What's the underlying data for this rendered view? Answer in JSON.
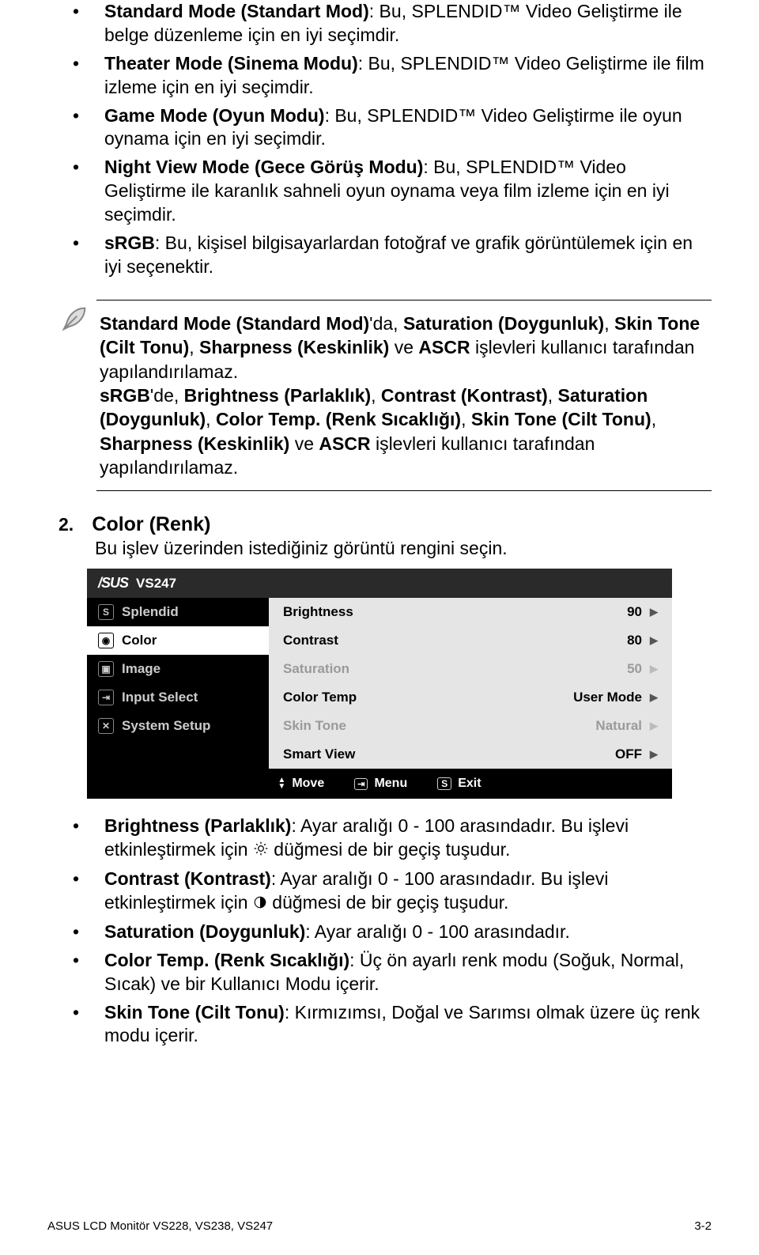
{
  "splendid_modes": [
    {
      "title": "Standard Mode (Standart Mod)",
      "desc": ": Bu, SPLENDID™ Video Geliştirme ile belge düzenleme için en iyi seçimdir."
    },
    {
      "title": "Theater Mode (Sinema Modu)",
      "desc": ": Bu, SPLENDID™ Video Geliştirme ile film izleme için en iyi seçimdir."
    },
    {
      "title": "Game Mode (Oyun Modu)",
      "desc": ": Bu, SPLENDID™ Video Geliştirme ile oyun oynama için en iyi seçimdir."
    },
    {
      "title": "Night View Mode (Gece Görüş Modu)",
      "desc": ": Bu, SPLENDID™ Video Geliştirme ile karanlık sahneli oyun oynama veya film izleme için en iyi seçimdir."
    },
    {
      "title": "sRGB",
      "desc": ": Bu, kişisel bilgisayarlardan fotoğraf ve grafik görüntülemek için en iyi seçenektir."
    }
  ],
  "note": {
    "p1a": "Standard Mode (Standard Mod)",
    "p1b": "'da, ",
    "p1c": "Saturation (Doygunluk)",
    "p1d": ", ",
    "p1e": "Skin Tone (Cilt Tonu)",
    "p1f": ", ",
    "p1g": "Sharpness (Keskinlik)",
    "p1h": " ve ",
    "p1i": "ASCR",
    "p1j": " işlevleri kullanıcı tarafından yapılandırılamaz.",
    "p2a": "sRGB",
    "p2b": "'de, ",
    "p2c": "Brightness (Parlaklık)",
    "p2d": ", ",
    "p2e": "Contrast (Kontrast)",
    "p2f": ", ",
    "p2g": "Saturation (Doygunluk)",
    "p2h": ", ",
    "p2i": "Color Temp. (Renk Sıcaklığı)",
    "p2j": ", ",
    "p2k": "Skin Tone (Cilt Tonu)",
    "p2l": ", ",
    "p2m": "Sharpness (Keskinlik)",
    "p2n": " ve ",
    "p2o": "ASCR",
    "p2p": " işlevleri kullanıcı tarafından yapılandırılamaz."
  },
  "section2": {
    "num": "2.",
    "title": "Color (Renk)",
    "desc": "Bu işlev üzerinden istediğiniz görüntü rengini seçin."
  },
  "osd": {
    "model": "VS247",
    "left": [
      "Splendid",
      "Color",
      "Image",
      "Input Select",
      "System Setup"
    ],
    "right": [
      {
        "label": "Brightness",
        "value": "90",
        "dim": false
      },
      {
        "label": "Contrast",
        "value": "80",
        "dim": false
      },
      {
        "label": "Saturation",
        "value": "50",
        "dim": true
      },
      {
        "label": "Color Temp",
        "value": "User Mode",
        "dim": false
      },
      {
        "label": "Skin Tone",
        "value": "Natural",
        "dim": true
      },
      {
        "label": "Smart View",
        "value": "OFF",
        "dim": false
      }
    ],
    "footer": {
      "move": "Move",
      "menu": "Menu",
      "exit": "Exit"
    }
  },
  "color_bullets": [
    {
      "title": "Brightness (Parlaklık)",
      "desc_a": ": Ayar aralığı 0 - 100 arasındadır. Bu işlevi etkinleştirmek için ",
      "icon": "sun",
      "desc_b": " düğmesi de bir geçiş tuşudur."
    },
    {
      "title": "Contrast (Kontrast)",
      "desc_a": ": Ayar aralığı 0 - 100 arasındadır. Bu işlevi etkinleştirmek için ",
      "icon": "contrast",
      "desc_b": " düğmesi de bir geçiş tuşudur."
    },
    {
      "title": "Saturation (Doygunluk)",
      "desc_a": ": Ayar aralığı 0 - 100 arasındadır.",
      "icon": "",
      "desc_b": ""
    },
    {
      "title": "Color Temp. (Renk Sıcaklığı)",
      "desc_a": ": Üç ön ayarlı renk modu (Soğuk, Normal, Sıcak) ve bir Kullanıcı Modu içerir.",
      "icon": "",
      "desc_b": ""
    },
    {
      "title": "Skin Tone (Cilt Tonu)",
      "desc_a": ": Kırmızımsı, Doğal ve Sarımsı olmak üzere üç renk modu içerir.",
      "icon": "",
      "desc_b": ""
    }
  ],
  "footer": {
    "left": "ASUS LCD Monitör VS228, VS238, VS247",
    "right": "3-2"
  }
}
